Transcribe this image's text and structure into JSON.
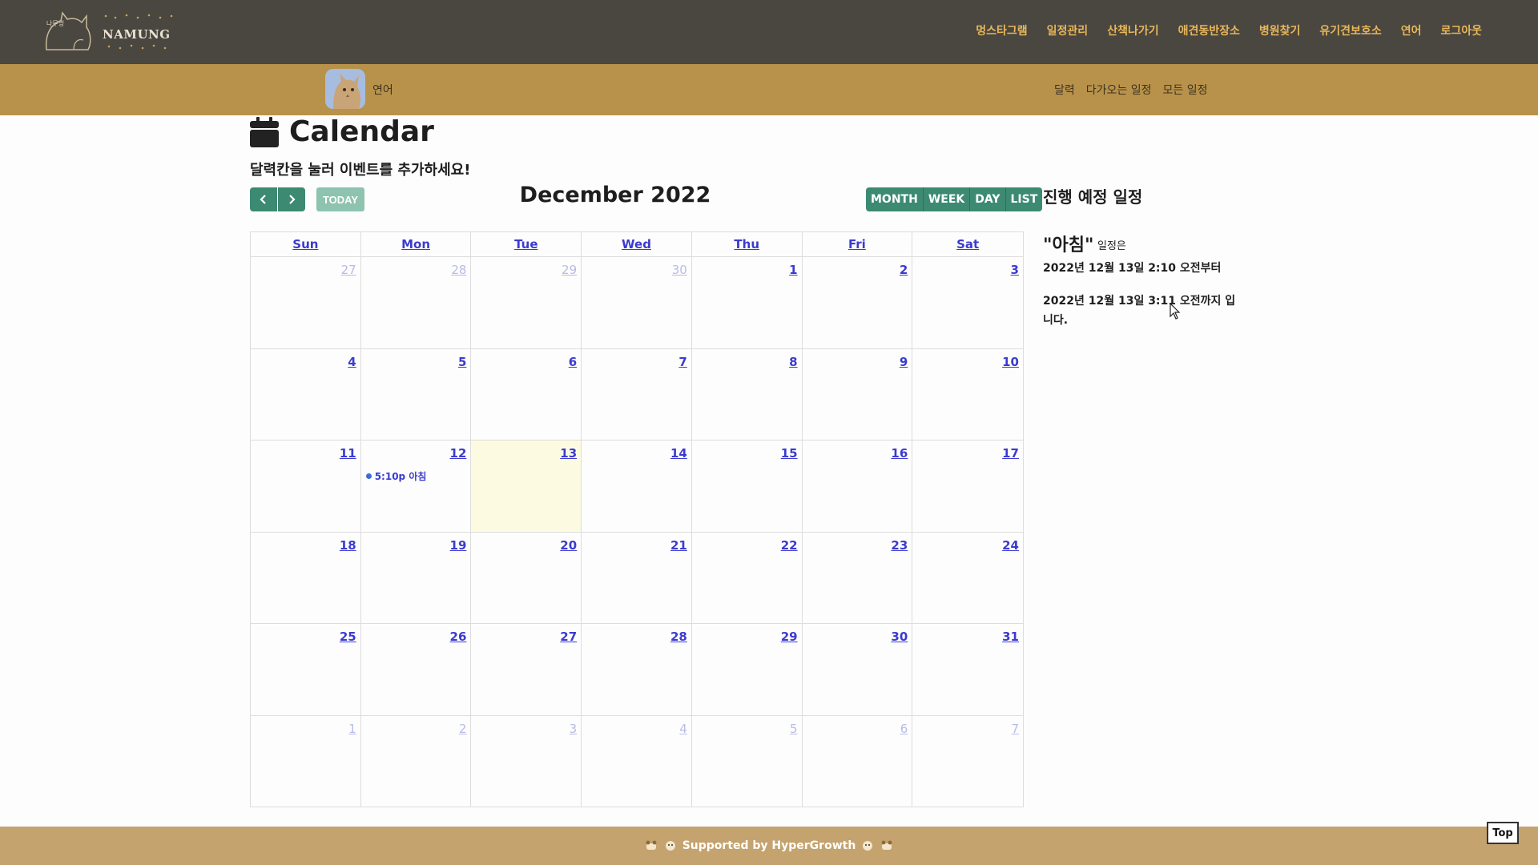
{
  "brand": {
    "name": "NAMUNG",
    "subtitle": "나무엉"
  },
  "nav": {
    "items": [
      "멍스타그램",
      "일정관리",
      "산책나가기",
      "애견동반장소",
      "병원찾기",
      "유기견보호소",
      "연어",
      "로그아웃"
    ]
  },
  "subnav": {
    "username": "연어",
    "links": [
      "달력",
      "다가오는 일정",
      "모든 일정"
    ]
  },
  "page": {
    "title": "Calendar",
    "instruction": "달력칸을 눌러 이벤트를 추가하세요!"
  },
  "toolbar": {
    "prev_icon": "chevron-left-icon",
    "next_icon": "chevron-right-icon",
    "today_label": "TODAY",
    "month_title": "December 2022",
    "views": [
      "MONTH",
      "WEEK",
      "DAY",
      "LIST"
    ]
  },
  "calendar": {
    "weekdays": [
      "Sun",
      "Mon",
      "Tue",
      "Wed",
      "Thu",
      "Fri",
      "Sat"
    ],
    "weeks": [
      [
        {
          "d": "27",
          "other": true
        },
        {
          "d": "28",
          "other": true
        },
        {
          "d": "29",
          "other": true
        },
        {
          "d": "30",
          "other": true
        },
        {
          "d": "1"
        },
        {
          "d": "2"
        },
        {
          "d": "3"
        }
      ],
      [
        {
          "d": "4"
        },
        {
          "d": "5"
        },
        {
          "d": "6"
        },
        {
          "d": "7"
        },
        {
          "d": "8"
        },
        {
          "d": "9"
        },
        {
          "d": "10"
        }
      ],
      [
        {
          "d": "11"
        },
        {
          "d": "12",
          "event": "5:10p 아침"
        },
        {
          "d": "13",
          "today": true
        },
        {
          "d": "14"
        },
        {
          "d": "15"
        },
        {
          "d": "16"
        },
        {
          "d": "17"
        }
      ],
      [
        {
          "d": "18"
        },
        {
          "d": "19"
        },
        {
          "d": "20"
        },
        {
          "d": "21"
        },
        {
          "d": "22"
        },
        {
          "d": "23"
        },
        {
          "d": "24"
        }
      ],
      [
        {
          "d": "25"
        },
        {
          "d": "26"
        },
        {
          "d": "27"
        },
        {
          "d": "28"
        },
        {
          "d": "29"
        },
        {
          "d": "30"
        },
        {
          "d": "31"
        }
      ],
      [
        {
          "d": "1",
          "other": true
        },
        {
          "d": "2",
          "other": true
        },
        {
          "d": "3",
          "other": true
        },
        {
          "d": "4",
          "other": true
        },
        {
          "d": "5",
          "other": true
        },
        {
          "d": "6",
          "other": true
        },
        {
          "d": "7",
          "other": true
        }
      ]
    ]
  },
  "side": {
    "title": "진행 예정 일정",
    "event_name": "\"아침\"",
    "event_suffix": "일정은",
    "from": "2022년 12월 13일 2:10 오전부터",
    "to": "2022년 12월 13일 3:11 오전까지 입니다."
  },
  "footer": {
    "text": "Supported by HyperGrowth"
  },
  "top_button": "Top",
  "colors": {
    "topbar": "#4a4640",
    "nav_text": "#e7b75a",
    "subbar": "#b8924a",
    "button_green": "#3d8a72",
    "today_green": "#8ec3af",
    "link_blue": "#3b3bd0",
    "today_cell": "#fcfbe2",
    "footer": "#c4a36e"
  }
}
